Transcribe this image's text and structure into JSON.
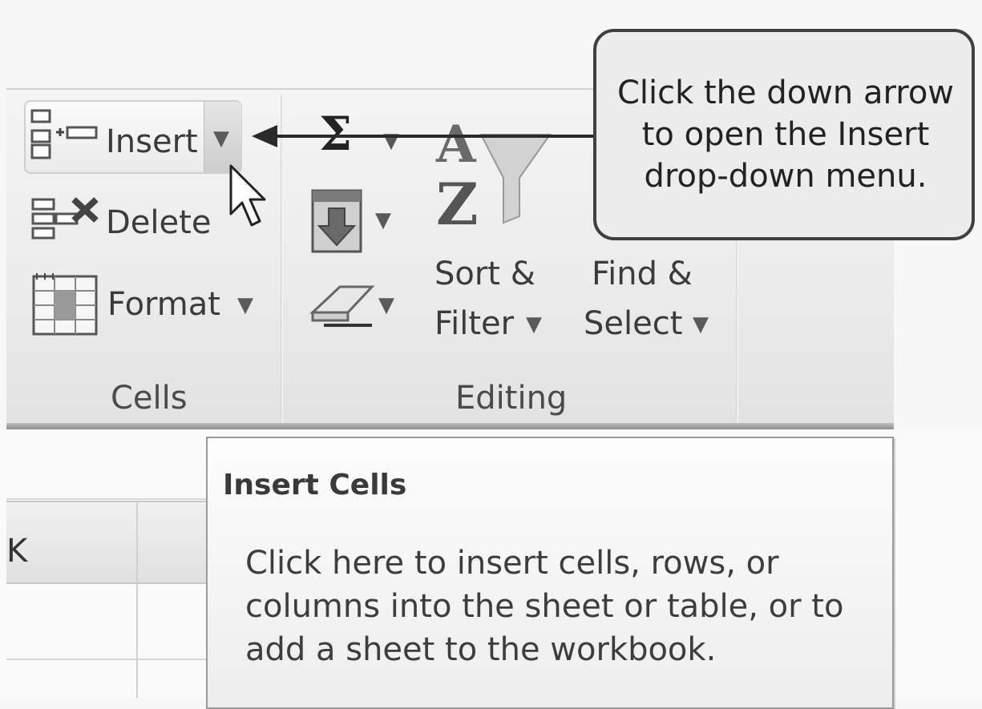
{
  "ribbon": {
    "cells_group": {
      "label": "Cells",
      "insert_label": "Insert",
      "delete_label": "Delete",
      "format_label": "Format"
    },
    "editing_group": {
      "label": "Editing",
      "autosum_label": "Σ",
      "sort_filter_line1": "Sort &",
      "sort_filter_line2": "Filter",
      "find_select_line1": "Find &",
      "find_select_line2": "Select"
    }
  },
  "callout": {
    "text": "Click the down arrow to open the Insert drop-down menu."
  },
  "sheet": {
    "column_header": "K"
  },
  "tooltip": {
    "title": "Insert Cells",
    "body": "Click here to insert cells, rows, or columns into the sheet or table, or to add a sheet to the workbook."
  },
  "icons": {
    "insert": "insert-cells-icon",
    "delete": "delete-cells-icon",
    "format": "format-cells-icon",
    "autosum": "sigma-icon",
    "fill": "fill-down-icon",
    "clear": "eraser-icon",
    "sort": "sort-az-icon",
    "cursor": "mouse-pointer-icon"
  }
}
